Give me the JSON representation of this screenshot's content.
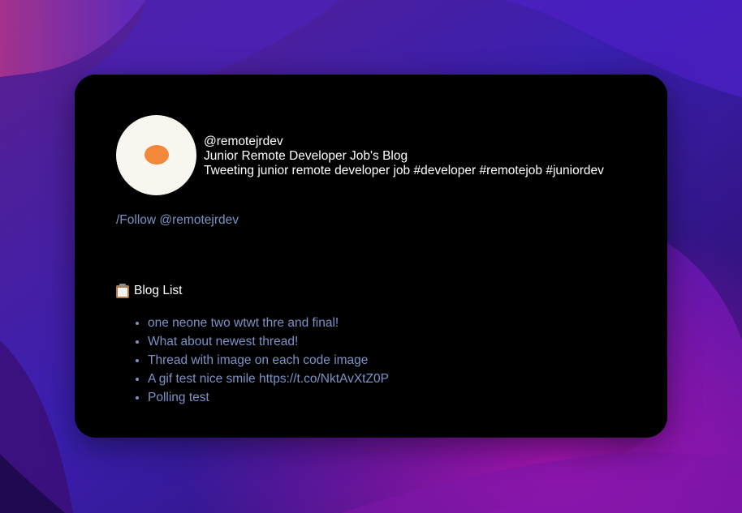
{
  "profile": {
    "handle": "@remotejrdev",
    "blog_title": "Junior Remote Developer Job's Blog",
    "bio": "Tweeting junior remote developer job #developer #remotejob #juniordev",
    "avatar_icon": "fried-egg-icon",
    "avatar_colors": {
      "white": "#f8f6ee",
      "yolk": "#f2883a"
    }
  },
  "follow": {
    "label": "/Follow @remotejrdev"
  },
  "blog_list": {
    "heading_icon": "clipboard-icon",
    "heading": "Blog List",
    "items": [
      "one neone two wtwt thre and final!",
      "What about newest thread!",
      "Thread with image on each code image",
      "A gif test nice smile https://t.co/NktAvXtZ0P",
      "Polling test"
    ]
  },
  "colors": {
    "card_background": "#000000",
    "link": "#7c93c6",
    "text": "#ffffff"
  }
}
